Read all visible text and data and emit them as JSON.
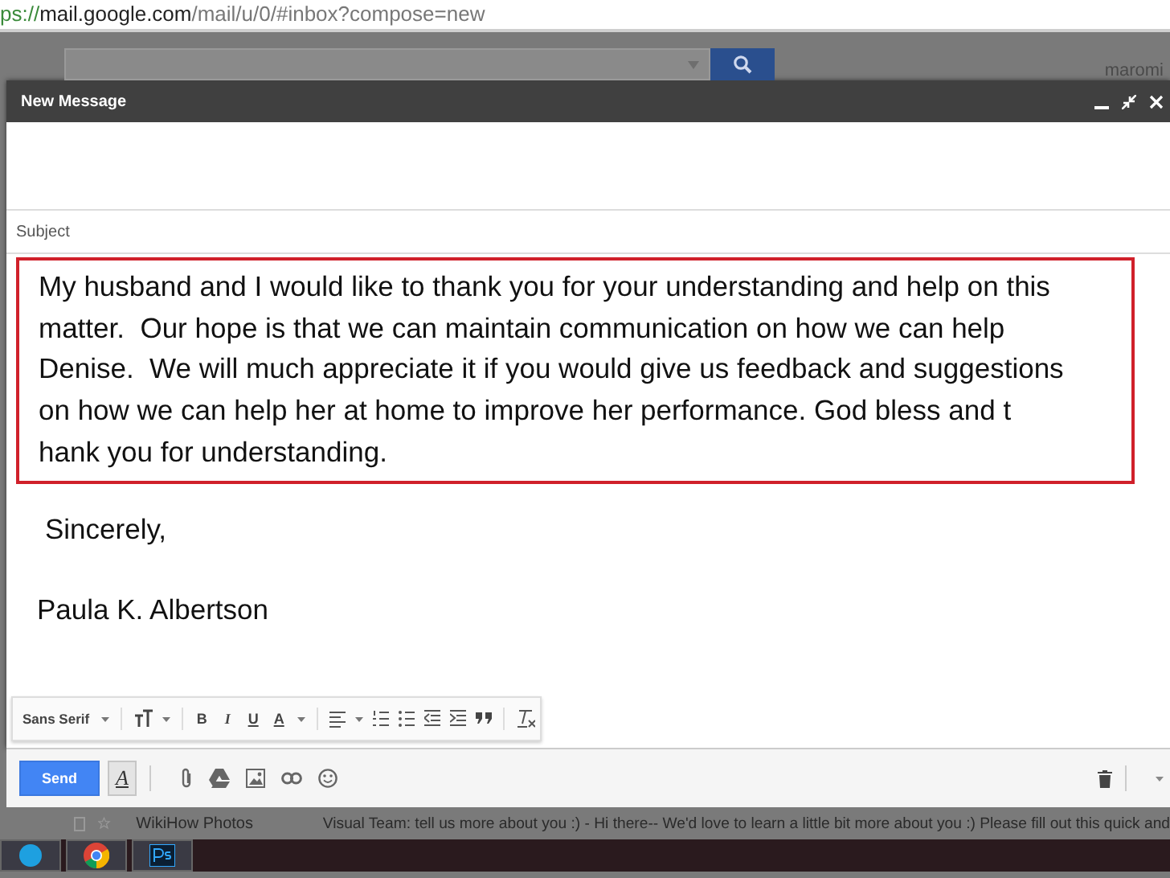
{
  "browser": {
    "url_prefix": "ps://",
    "url_host": "mail.google.com",
    "url_path": "/mail/u/0/#inbox?compose=new"
  },
  "gmail": {
    "account": "maromi"
  },
  "compose": {
    "title": "New Message",
    "subject_placeholder": "Subject",
    "body_lines": [
      "My husband and I would like to thank you for your understanding and help on this",
      "matter.  Our hope is that we can maintain communication on how we can help",
      "Denise.  We will much appreciate it if you would give us feedback and suggestions",
      "on how we can help her at home to improve her performance. God bless and t",
      "hank you for understanding."
    ],
    "closing": "Sincerely,",
    "signature": "Paula K. Albertson",
    "format_bar": {
      "font": "Sans Serif",
      "bold": "B",
      "italic": "I",
      "underline": "U",
      "text_color": "A"
    },
    "send": "Send",
    "formatting_toggle": {
      "label": "A",
      "on": true
    }
  },
  "inbox": [
    {
      "sender": "WikiHow Photos",
      "preview": "Visual Team: tell us more about you :) - Hi there-- We'd love to learn a little bit more about you :) Please fill out this quick and",
      "checked": false,
      "starred": false
    }
  ]
}
